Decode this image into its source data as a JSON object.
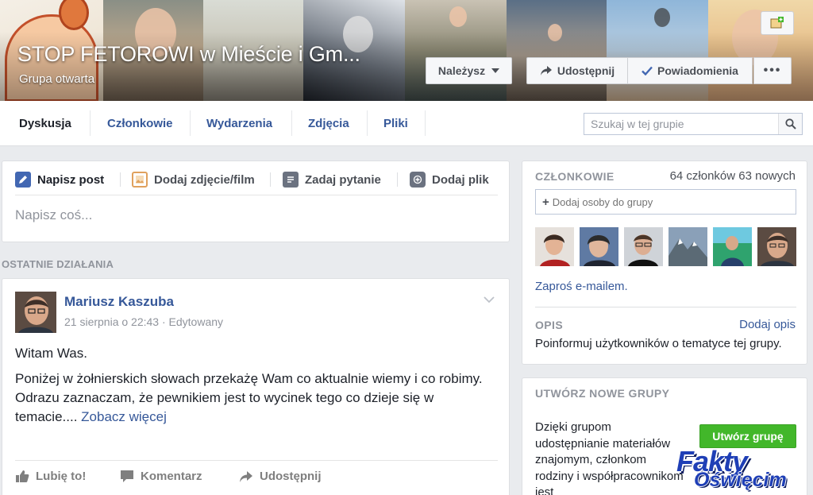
{
  "cover": {
    "title": "STOP FETOROWI w Mieście i Gm...",
    "subtitle": "Grupa otwarta",
    "member_button": "Należysz",
    "share_button": "Udostępnij",
    "notify_button": "Powiadomienia",
    "more_button": "•••"
  },
  "tabs": [
    {
      "label": "Dyskusja"
    },
    {
      "label": "Członkowie"
    },
    {
      "label": "Wydarzenia"
    },
    {
      "label": "Zdjęcia"
    },
    {
      "label": "Pliki"
    }
  ],
  "group_search": {
    "placeholder": "Szukaj w tej grupie"
  },
  "composer": {
    "tabs": [
      {
        "label": "Napisz post",
        "icon": "pencil-icon"
      },
      {
        "label": "Dodaj zdjęcie/film",
        "icon": "photo-icon"
      },
      {
        "label": "Zadaj pytanie",
        "icon": "question-icon"
      },
      {
        "label": "Dodaj plik",
        "icon": "file-plus-icon"
      }
    ],
    "placeholder": "Napisz coś..."
  },
  "recent_label": "OSTATNIE DZIAŁANIA",
  "post": {
    "author": "Mariusz Kaszuba",
    "meta": "21 sierpnia o 22:43 · Edytowany",
    "greeting": "Witam Was.",
    "paragraph": "Poniżej w żołnierskich słowach przekażę Wam co aktualnie wiemy i co robimy.",
    "paragraph2": "Odrazu zaznaczam, że pewnikiem jest to wycinek tego co dzieje się w temacie....",
    "see_more": "Zobacz więcej",
    "actions": {
      "like": "Lubię to!",
      "comment": "Komentarz",
      "share": "Udostępnij"
    }
  },
  "members_panel": {
    "heading": "CZŁONKOWIE",
    "count": "64 członków 63 nowych",
    "add_placeholder": "Dodaj osoby do grupy",
    "invite_link": "Zaproś e-mailem.",
    "desc_heading": "OPIS",
    "add_desc_link": "Dodaj opis",
    "desc_text": "Poinformuj użytkowników o tematyce tej grupy."
  },
  "create_panel": {
    "heading": "UTWÓRZ NOWE GRUPY",
    "text": "Dzięki grupom udostępnianie materiałów znajomym, członkom rodziny i współpracownikom jest",
    "button": "Utwórz grupę"
  },
  "watermark": {
    "line1": "Fakty",
    "line2": "Oświęcim"
  },
  "colors": {
    "link": "#365899",
    "create_button": "#42b72a",
    "watermark": "#1f3fb6"
  }
}
